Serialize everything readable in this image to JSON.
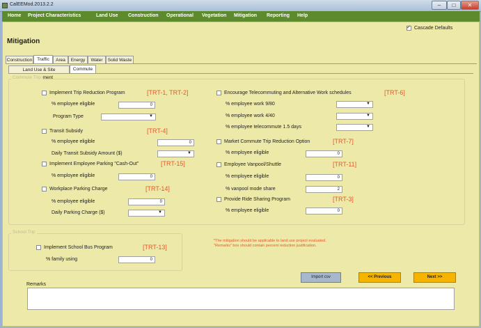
{
  "window": {
    "title": "CalEEMod.2013.2.2",
    "minimize": "–",
    "maximize": "□",
    "close": "✕"
  },
  "menu": [
    "Home",
    "Project Characteristics",
    "Land Use",
    "Construction",
    "Operational",
    "Vegetation",
    "Mitigation",
    "Reporting",
    "Help"
  ],
  "cascade_label": "Cascade Defaults",
  "page_title": "Mitigation",
  "main_tabs": [
    "Construction",
    "Traffic",
    "Area",
    "Energy",
    "Water",
    "Solid Waste"
  ],
  "sub_tabs": [
    "Land Use & Site Enhancement",
    "Commute"
  ],
  "commute_group_title": "Commute Trip",
  "left": {
    "ctr": {
      "label": "Implement Trip Reduction Program",
      "code": "[TRT-1, TRT-2]",
      "eligible_label": "% employee eligible",
      "eligible_value": "0",
      "program_type_label": "Program Type"
    },
    "transit": {
      "label": "Transit Subsidy",
      "code": "[TRT-4]",
      "eligible_label": "% employee eligible",
      "eligible_value": "0",
      "amount_label": "Daily Transit Subsidy Amount ($)"
    },
    "cashout": {
      "label": "Implement Employee Parking \"Cash-Out\"",
      "code": "[TRT-15]",
      "eligible_label": "% employee eligible",
      "eligible_value": "0"
    },
    "parking": {
      "label": "Workplace Parking Charge",
      "code": "[TRT-14]",
      "eligible_label": "% employee eligible",
      "eligible_value": "0",
      "charge_label": "Daily Parking Charge ($)"
    }
  },
  "right": {
    "telecommute": {
      "label": "Encourage Telecommuting and Alternative Work schedules",
      "code": "[TRT-6]",
      "row1": "% employee work 9/80",
      "row2": "% employee work 4/40",
      "row3": "% employee telecommute 1.5 days"
    },
    "market": {
      "label": "Market Commute Trip Reduction Option",
      "code": "[TRT-7]",
      "eligible_label": "% employee eligible",
      "eligible_value": "0"
    },
    "vanpool": {
      "label": "Employee Vanpool/Shuttle",
      "code": "[TRT-11]",
      "eligible_label": "% employee eligible",
      "eligible_value": "0",
      "share_label": "% vanpool mode share",
      "share_value": "2"
    },
    "rideshare": {
      "label": "Provide Ride Sharing Program",
      "code": "[TRT-3]",
      "eligible_label": "% employee eligible",
      "eligible_value": "0"
    }
  },
  "school_group_title": "School Trip",
  "school": {
    "label": "Implement School Bus Program",
    "code": "[TRT-13]",
    "family_label": "% family using",
    "family_value": "0"
  },
  "notes": [
    "*The mitigation should be applicable to land use project evaluated.",
    "\"Remarks\" box should contain percent reduction justification."
  ],
  "buttons": {
    "import": "Import csv",
    "previous": "<< Previous",
    "next": "Next >>"
  },
  "remarks_label": "Remarks",
  "colors": {
    "menubar": "#5e8a2e",
    "panel": "#ede9a8",
    "code": "#e8572b",
    "nav_button": "#f5b400"
  }
}
